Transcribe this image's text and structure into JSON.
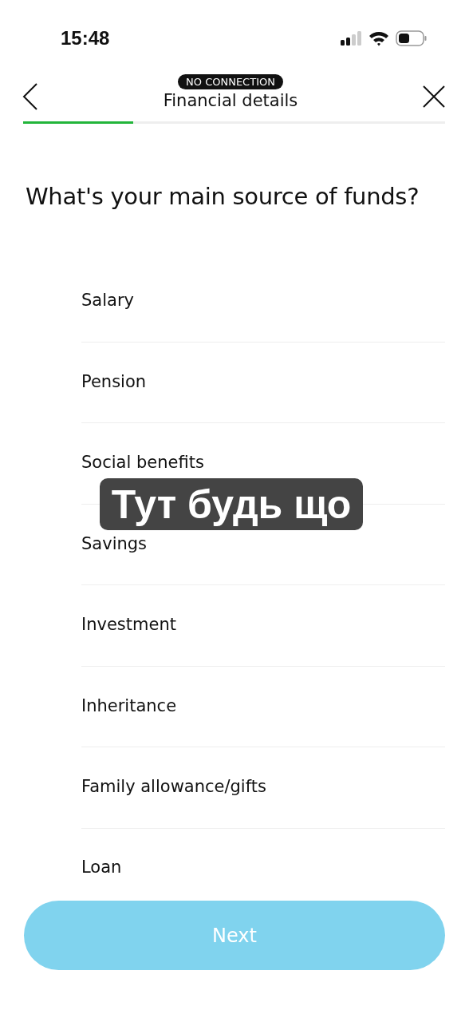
{
  "status_bar": {
    "time": "15:48"
  },
  "header": {
    "badge": "NO CONNECTION",
    "title": "Financial details"
  },
  "progress": {
    "level": 0.26
  },
  "question": "What's your main source of funds?",
  "options": [
    {
      "label": "Salary"
    },
    {
      "label": "Pension"
    },
    {
      "label": "Social benefits"
    },
    {
      "label": "Savings"
    },
    {
      "label": "Investment"
    },
    {
      "label": "Inheritance"
    },
    {
      "label": "Family allowance/gifts"
    },
    {
      "label": "Loan"
    }
  ],
  "next_button": {
    "label": "Next",
    "disabled": true
  },
  "overlay_caption": "Тут будь що"
}
